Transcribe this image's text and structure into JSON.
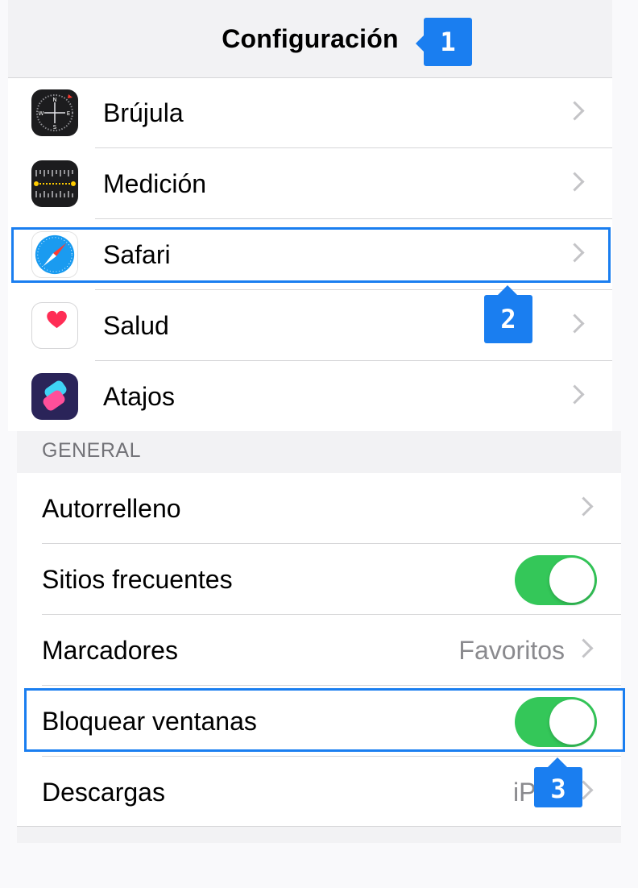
{
  "header": {
    "title": "Configuración"
  },
  "apps": [
    {
      "label": "Brújula",
      "icon": "compass-icon"
    },
    {
      "label": "Medición",
      "icon": "measure-icon"
    },
    {
      "label": "Safari",
      "icon": "safari-icon"
    },
    {
      "label": "Salud",
      "icon": "health-icon"
    },
    {
      "label": "Atajos",
      "icon": "shortcuts-icon"
    }
  ],
  "general": {
    "header": "GENERAL",
    "rows": [
      {
        "label": "Autorrelleno",
        "type": "chevron"
      },
      {
        "label": "Sitios frecuentes",
        "type": "toggle",
        "on": true
      },
      {
        "label": "Marcadores",
        "type": "value",
        "value": "Favoritos"
      },
      {
        "label": "Bloquear ventanas",
        "type": "toggle",
        "on": true
      },
      {
        "label": "Descargas",
        "type": "value",
        "value": "iPho"
      }
    ]
  },
  "annotations": {
    "badge1": "1",
    "badge2": "2",
    "badge3": "3"
  },
  "colors": {
    "accent": "#1a7ef0",
    "toggle_on": "#34c759"
  }
}
